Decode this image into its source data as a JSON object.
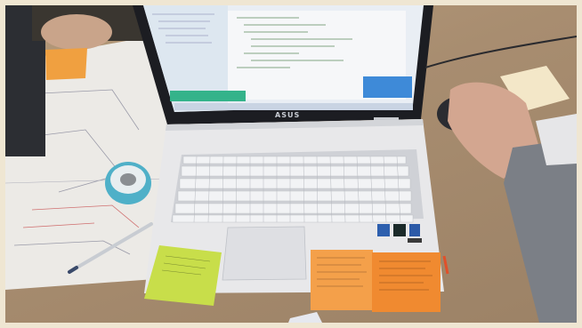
{
  "laptop": {
    "brand": "ASUS"
  },
  "colors": {
    "desk": "#a88d70",
    "laptop_body": "#e8e8ea",
    "screen_editor": "#f4f5f7",
    "sticky_green": "#c8de4a",
    "sticky_orange": "#f4a04a",
    "sticky_dark_orange": "#f08a30"
  }
}
